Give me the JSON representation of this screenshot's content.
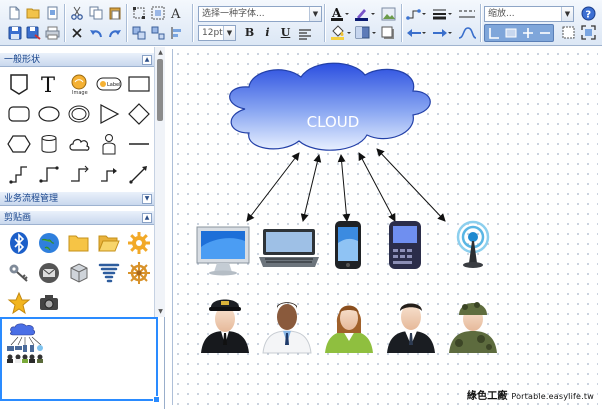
{
  "toolbar": {
    "font_combo": "选择一种字体...",
    "font_size": "12pt",
    "zoom_combo": "缩放...",
    "bold": "B",
    "italic": "i",
    "underline": "U",
    "font_color_letter": "A"
  },
  "sidebar": {
    "sections": [
      {
        "label": "一般形状",
        "collapsed": false
      },
      {
        "label": "业务流程管理",
        "collapsed": true
      },
      {
        "label": "剪贴画",
        "collapsed": false
      }
    ],
    "shapes": [
      "note",
      "text",
      "image",
      "label",
      "rectangle",
      "rounded-rect",
      "ellipse",
      "double-ellipse",
      "triangle",
      "rhombus",
      "hexagon",
      "cylinder",
      "cloud",
      "actor",
      "line",
      "connector-elbow",
      "connector-step",
      "connector-curve",
      "connector-arrow",
      "connector-straight"
    ],
    "clipart": [
      "bluetooth-icon",
      "globe-icon",
      "folder-icon",
      "open-folder-icon",
      "gear-icon",
      "keys-icon",
      "mail-icon",
      "cube-icon",
      "tornado-icon",
      "helm-icon",
      "star-icon",
      "camera-icon"
    ]
  },
  "diagram": {
    "cloud_label": "CLOUD",
    "devices": [
      "desktop-monitor",
      "netbook",
      "smartphone",
      "blackberry",
      "wireless-antenna"
    ],
    "people": [
      "pilot",
      "doctor",
      "businesswoman",
      "businessman",
      "soldier"
    ]
  },
  "watermark": {
    "main": "綠色工廠",
    "tail": "Portable.easylife.tw"
  },
  "colors": {
    "selection": "#2a8bff",
    "cloud_top": "#2b4fe0",
    "cloud_bottom": "#e8f0ff",
    "header_text": "#15428b"
  }
}
